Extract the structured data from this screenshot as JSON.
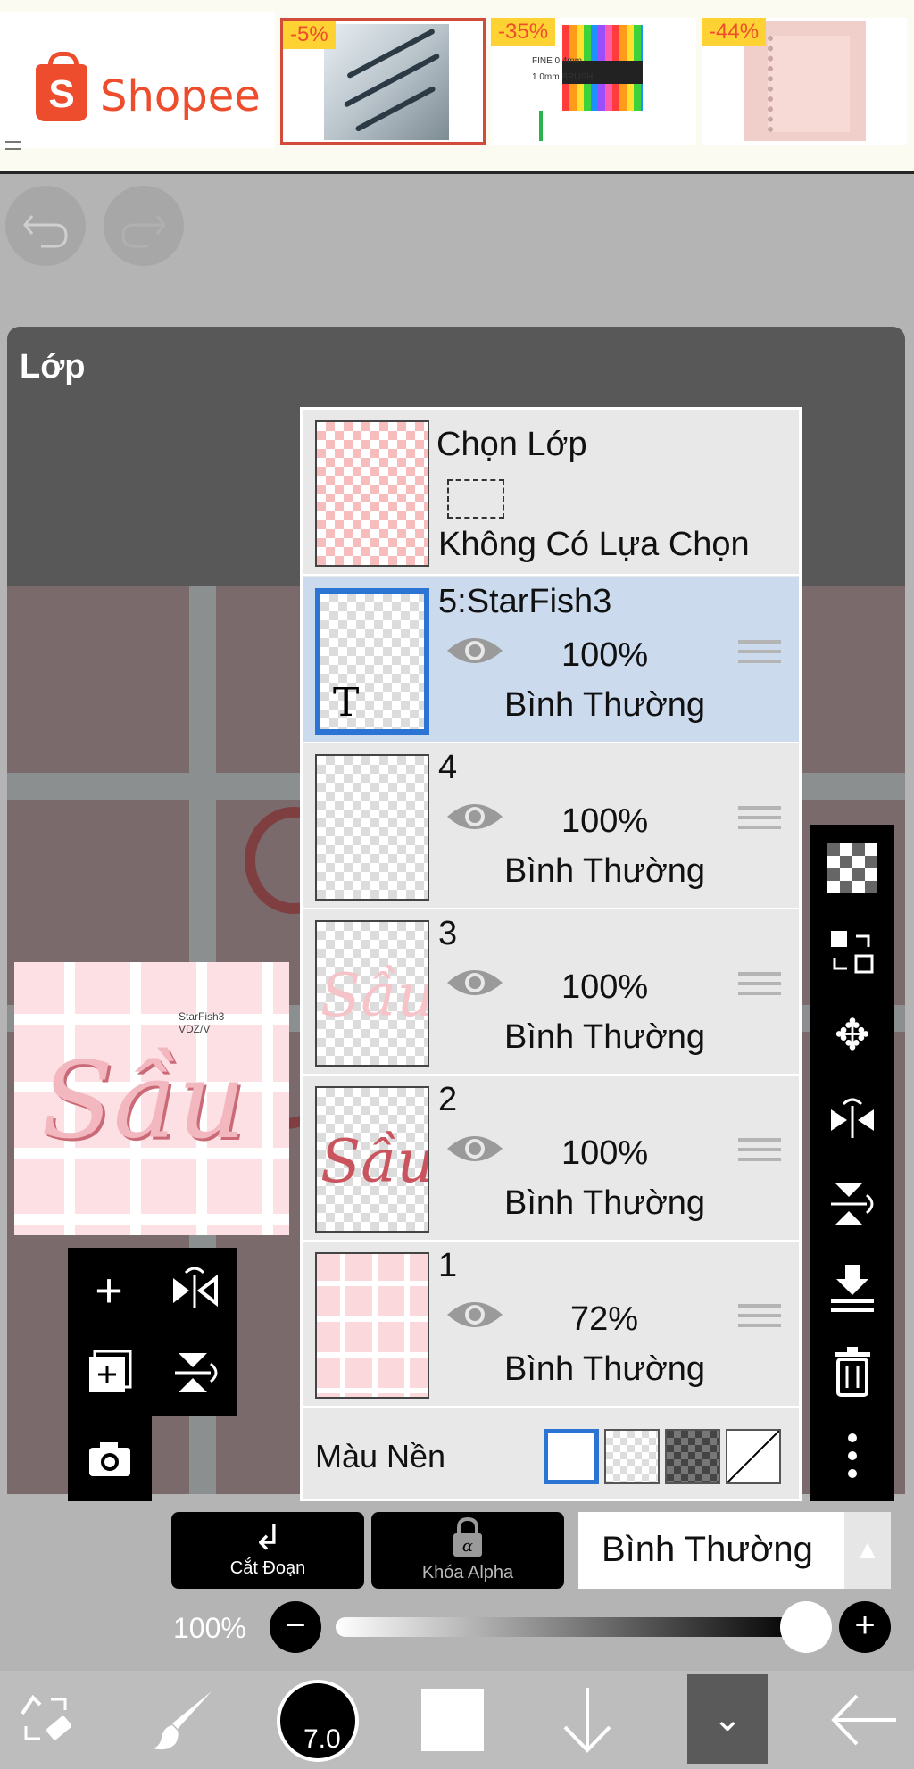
{
  "ad": {
    "brand": "Shopee",
    "products": [
      {
        "discount": "-5%"
      },
      {
        "discount": "-35%",
        "caption": "FINE 0.4mm\n1.0mm BRUSH"
      },
      {
        "discount": "-44%"
      }
    ]
  },
  "panel": {
    "title": "Lớp"
  },
  "preview": {
    "word": "Sầu",
    "small_text": "StarFish3\nVDZ/V"
  },
  "selection_row": {
    "title": "Chọn Lớp",
    "status": "Không Có Lựa Chọn"
  },
  "layers": [
    {
      "name": "5:StarFish3",
      "opacity": "100%",
      "blend": "Bình Thường",
      "selected": true,
      "thumb_char": "T"
    },
    {
      "name": "4",
      "opacity": "100%",
      "blend": "Bình Thường"
    },
    {
      "name": "3",
      "opacity": "100%",
      "blend": "Bình Thường",
      "thumb_word": "Sầu"
    },
    {
      "name": "2",
      "opacity": "100%",
      "blend": "Bình Thường",
      "thumb_word": "Sầu"
    },
    {
      "name": "1",
      "opacity": "72%",
      "blend": "Bình Thường"
    }
  ],
  "background": {
    "label": "Màu Nền"
  },
  "buttons": {
    "clipping": "Cắt Đoạn",
    "alpha_lock": "Khóa Alpha"
  },
  "blend_mode": {
    "value": "Bình Thường"
  },
  "opacity": {
    "label": "100%",
    "value_percent": 100
  },
  "brush": {
    "size": "7.0"
  },
  "colors": {
    "accent": "#2c74d4",
    "shopee": "#ee4d2d",
    "selected_row": "#ccdaee"
  }
}
